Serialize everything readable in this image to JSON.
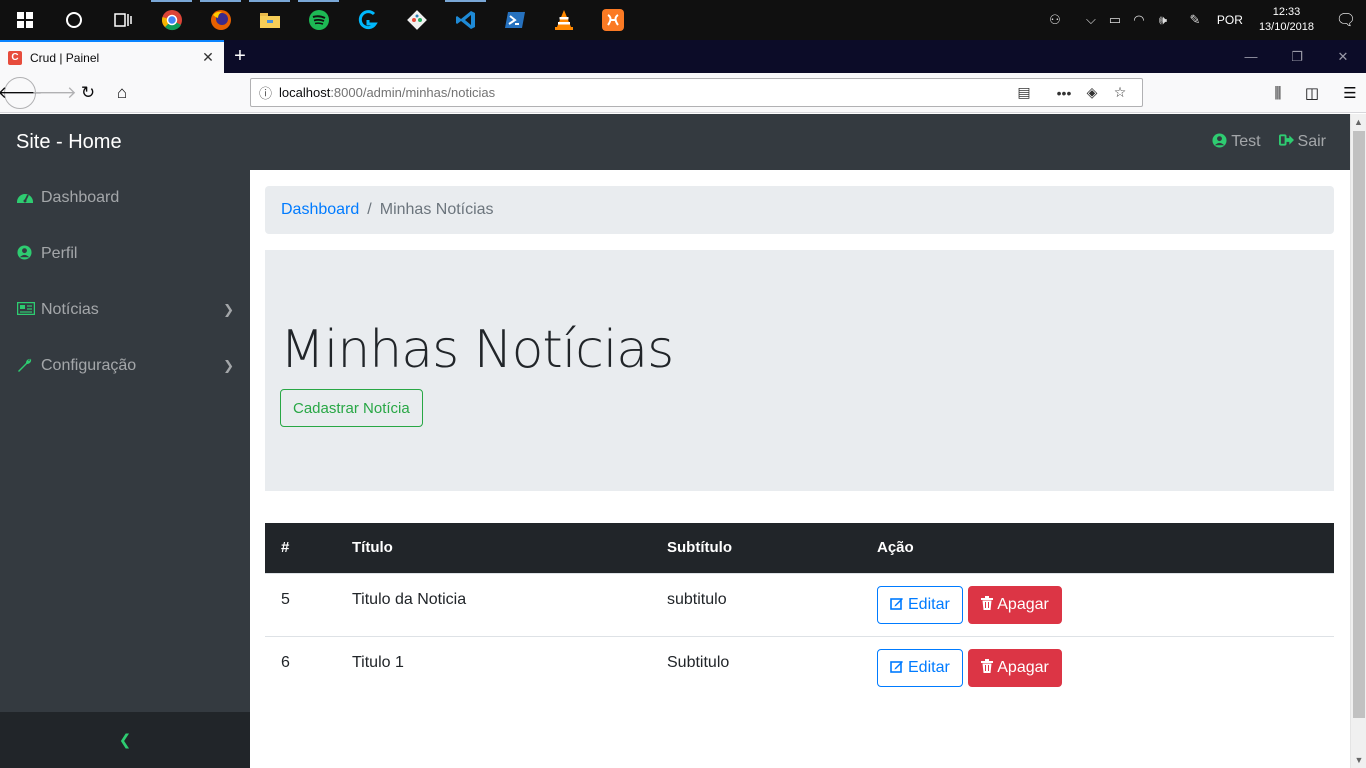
{
  "taskbar": {
    "lang": "POR",
    "time": "12:33",
    "date": "13/10/2018"
  },
  "browser": {
    "tab_title": "Crud | Painel",
    "url_host": "localhost",
    "url_rest": ":8000/admin/minhas/noticias"
  },
  "app": {
    "brand": "Site - Home",
    "user_label": "Test",
    "logout_label": "Sair"
  },
  "sidebar": {
    "items": [
      {
        "label": "Dashboard",
        "icon": "dashboard-icon"
      },
      {
        "label": "Perfil",
        "icon": "user-circle-icon"
      },
      {
        "label": "Notícias",
        "icon": "newspaper-icon"
      },
      {
        "label": "Configuração",
        "icon": "wrench-icon"
      }
    ]
  },
  "breadcrumb": {
    "link": "Dashboard",
    "separator": "/",
    "active": "Minhas Notícias"
  },
  "jumbotron": {
    "title": "Minhas Notícias",
    "button_label": "Cadastrar Notícia"
  },
  "table": {
    "headers": [
      "#",
      "Título",
      "Subtítulo",
      "Ação"
    ],
    "rows": [
      {
        "id": "5",
        "titulo": "Titulo da Noticia",
        "subtitulo": "subtitulo"
      },
      {
        "id": "6",
        "titulo": "Titulo 1",
        "subtitulo": "Subtitulo"
      }
    ],
    "edit_label": "Editar",
    "delete_label": "Apagar"
  },
  "colors": {
    "accent_green": "#2ecc71",
    "primary_blue": "#007bff",
    "danger_red": "#dc3545",
    "dark": "#343a40"
  }
}
